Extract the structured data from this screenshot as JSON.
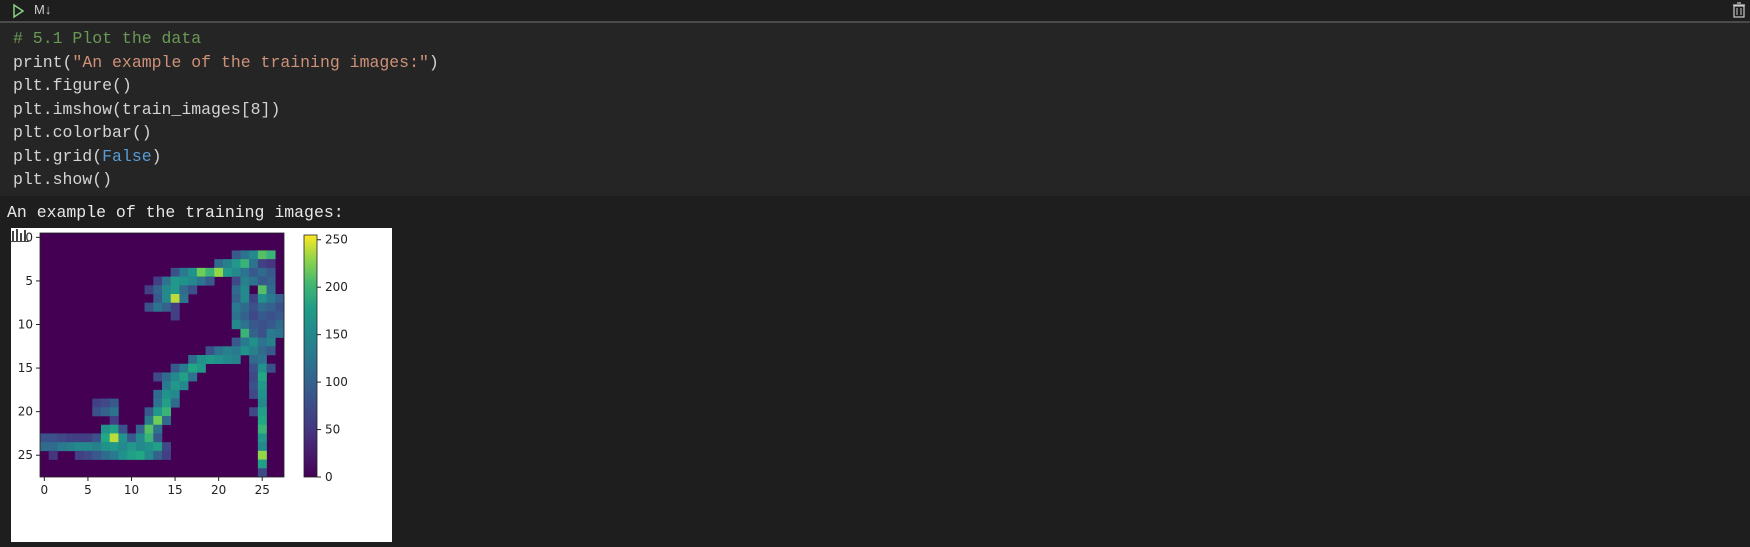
{
  "toolbar": {
    "run_icon": "play-icon",
    "cell_type": "M↓",
    "delete_icon": "trash-icon"
  },
  "code_cell": {
    "lines": [
      [
        {
          "t": "comment",
          "v": "# 5.1 Plot the data"
        }
      ],
      [
        {
          "t": "text",
          "v": "print("
        },
        {
          "t": "string",
          "v": "\"An example of the training images:\""
        },
        {
          "t": "text",
          "v": ")"
        }
      ],
      [
        {
          "t": "text",
          "v": "plt.figure()"
        }
      ],
      [
        {
          "t": "text",
          "v": "plt.imshow(train_images[8])"
        }
      ],
      [
        {
          "t": "text",
          "v": "plt.colorbar()"
        }
      ],
      [
        {
          "t": "text",
          "v": "plt.grid("
        },
        {
          "t": "const",
          "v": "False"
        },
        {
          "t": "text",
          "v": ")"
        }
      ],
      [
        {
          "t": "text",
          "v": "plt.show()"
        }
      ]
    ]
  },
  "output": {
    "text": "An example of the training images:"
  },
  "chart_data": {
    "type": "heatmap",
    "colormap": "viridis",
    "x_ticks": [
      "0",
      "5",
      "10",
      "15",
      "20",
      "25"
    ],
    "y_ticks": [
      "0",
      "5",
      "10",
      "15",
      "20",
      "25"
    ],
    "xlim": [
      0,
      27
    ],
    "ylim": [
      0,
      27
    ],
    "colorbar_ticks": [
      "0",
      "50",
      "100",
      "150",
      "200",
      "250"
    ],
    "colorbar_range": [
      0,
      255
    ],
    "grid": false,
    "rows": 28,
    "cols": 28,
    "nonzero_pixels": [
      [
        2,
        22,
        90
      ],
      [
        2,
        23,
        120
      ],
      [
        2,
        24,
        150
      ],
      [
        2,
        25,
        210
      ],
      [
        2,
        26,
        200
      ],
      [
        3,
        20,
        110
      ],
      [
        3,
        21,
        140
      ],
      [
        3,
        22,
        170
      ],
      [
        3,
        23,
        200
      ],
      [
        3,
        24,
        120
      ],
      [
        3,
        25,
        60
      ],
      [
        3,
        26,
        50
      ],
      [
        4,
        15,
        80
      ],
      [
        4,
        16,
        130
      ],
      [
        4,
        17,
        160
      ],
      [
        4,
        18,
        220
      ],
      [
        4,
        19,
        200
      ],
      [
        4,
        20,
        230
      ],
      [
        4,
        21,
        170
      ],
      [
        4,
        22,
        150
      ],
      [
        4,
        23,
        120
      ],
      [
        4,
        24,
        90
      ],
      [
        4,
        25,
        110
      ],
      [
        4,
        26,
        90
      ],
      [
        5,
        13,
        60
      ],
      [
        5,
        14,
        120
      ],
      [
        5,
        15,
        170
      ],
      [
        5,
        16,
        160
      ],
      [
        5,
        17,
        150
      ],
      [
        5,
        18,
        120
      ],
      [
        5,
        19,
        90
      ],
      [
        5,
        22,
        70
      ],
      [
        5,
        23,
        140
      ],
      [
        5,
        24,
        120
      ],
      [
        5,
        25,
        90
      ],
      [
        5,
        26,
        100
      ],
      [
        6,
        12,
        60
      ],
      [
        6,
        13,
        100
      ],
      [
        6,
        14,
        150
      ],
      [
        6,
        15,
        170
      ],
      [
        6,
        16,
        110
      ],
      [
        6,
        17,
        80
      ],
      [
        6,
        22,
        110
      ],
      [
        6,
        23,
        150
      ],
      [
        6,
        25,
        210
      ],
      [
        6,
        26,
        110
      ],
      [
        7,
        13,
        90
      ],
      [
        7,
        14,
        150
      ],
      [
        7,
        15,
        240
      ],
      [
        7,
        16,
        120
      ],
      [
        7,
        22,
        100
      ],
      [
        7,
        23,
        150
      ],
      [
        7,
        24,
        60
      ],
      [
        7,
        25,
        160
      ],
      [
        7,
        26,
        130
      ],
      [
        7,
        27,
        100
      ],
      [
        8,
        12,
        80
      ],
      [
        8,
        13,
        120
      ],
      [
        8,
        14,
        100
      ],
      [
        8,
        15,
        60
      ],
      [
        8,
        22,
        130
      ],
      [
        8,
        23,
        110
      ],
      [
        8,
        24,
        80
      ],
      [
        8,
        25,
        110
      ],
      [
        8,
        26,
        100
      ],
      [
        8,
        27,
        80
      ],
      [
        9,
        15,
        60
      ],
      [
        9,
        22,
        120
      ],
      [
        9,
        23,
        100
      ],
      [
        9,
        24,
        70
      ],
      [
        9,
        25,
        90
      ],
      [
        9,
        26,
        80
      ],
      [
        9,
        27,
        90
      ],
      [
        10,
        22,
        150
      ],
      [
        10,
        23,
        120
      ],
      [
        10,
        24,
        90
      ],
      [
        10,
        25,
        80
      ],
      [
        10,
        26,
        90
      ],
      [
        10,
        27,
        110
      ],
      [
        11,
        23,
        200
      ],
      [
        11,
        24,
        100
      ],
      [
        11,
        25,
        80
      ],
      [
        11,
        26,
        130
      ],
      [
        11,
        27,
        120
      ],
      [
        12,
        22,
        90
      ],
      [
        12,
        23,
        130
      ],
      [
        12,
        24,
        160
      ],
      [
        12,
        25,
        120
      ],
      [
        12,
        26,
        140
      ],
      [
        13,
        19,
        80
      ],
      [
        13,
        20,
        120
      ],
      [
        13,
        21,
        140
      ],
      [
        13,
        22,
        130
      ],
      [
        13,
        23,
        160
      ],
      [
        13,
        24,
        140
      ],
      [
        13,
        25,
        110
      ],
      [
        13,
        26,
        90
      ],
      [
        14,
        17,
        110
      ],
      [
        14,
        18,
        160
      ],
      [
        14,
        19,
        170
      ],
      [
        14,
        20,
        160
      ],
      [
        14,
        21,
        150
      ],
      [
        14,
        22,
        140
      ],
      [
        14,
        24,
        110
      ],
      [
        14,
        25,
        120
      ],
      [
        15,
        15,
        90
      ],
      [
        15,
        16,
        130
      ],
      [
        15,
        17,
        190
      ],
      [
        15,
        18,
        170
      ],
      [
        15,
        24,
        80
      ],
      [
        15,
        25,
        160
      ],
      [
        15,
        26,
        80
      ],
      [
        16,
        13,
        70
      ],
      [
        16,
        14,
        110
      ],
      [
        16,
        15,
        150
      ],
      [
        16,
        16,
        180
      ],
      [
        16,
        17,
        120
      ],
      [
        16,
        24,
        70
      ],
      [
        16,
        25,
        190
      ],
      [
        17,
        14,
        130
      ],
      [
        17,
        15,
        170
      ],
      [
        17,
        16,
        150
      ],
      [
        17,
        24,
        80
      ],
      [
        17,
        25,
        170
      ],
      [
        18,
        13,
        110
      ],
      [
        18,
        14,
        160
      ],
      [
        18,
        15,
        150
      ],
      [
        18,
        24,
        70
      ],
      [
        18,
        25,
        160
      ],
      [
        19,
        6,
        60
      ],
      [
        19,
        7,
        70
      ],
      [
        19,
        8,
        90
      ],
      [
        19,
        13,
        120
      ],
      [
        19,
        14,
        180
      ],
      [
        19,
        15,
        110
      ],
      [
        19,
        25,
        150
      ],
      [
        20,
        6,
        80
      ],
      [
        20,
        7,
        100
      ],
      [
        20,
        8,
        120
      ],
      [
        20,
        12,
        90
      ],
      [
        20,
        13,
        170
      ],
      [
        20,
        14,
        200
      ],
      [
        20,
        24,
        70
      ],
      [
        20,
        25,
        180
      ],
      [
        21,
        8,
        60
      ],
      [
        21,
        12,
        130
      ],
      [
        21,
        13,
        220
      ],
      [
        21,
        14,
        110
      ],
      [
        21,
        25,
        190
      ],
      [
        22,
        7,
        160
      ],
      [
        22,
        8,
        180
      ],
      [
        22,
        9,
        80
      ],
      [
        22,
        11,
        100
      ],
      [
        22,
        12,
        210
      ],
      [
        22,
        13,
        120
      ],
      [
        22,
        25,
        200
      ],
      [
        23,
        0,
        80
      ],
      [
        23,
        1,
        80
      ],
      [
        23,
        2,
        70
      ],
      [
        23,
        3,
        60
      ],
      [
        23,
        4,
        60
      ],
      [
        23,
        5,
        60
      ],
      [
        23,
        6,
        80
      ],
      [
        23,
        7,
        190
      ],
      [
        23,
        8,
        240
      ],
      [
        23,
        9,
        160
      ],
      [
        23,
        10,
        90
      ],
      [
        23,
        11,
        150
      ],
      [
        23,
        12,
        200
      ],
      [
        23,
        13,
        90
      ],
      [
        23,
        25,
        170
      ],
      [
        24,
        0,
        110
      ],
      [
        24,
        1,
        110
      ],
      [
        24,
        2,
        130
      ],
      [
        24,
        3,
        140
      ],
      [
        24,
        4,
        150
      ],
      [
        24,
        5,
        150
      ],
      [
        24,
        6,
        140
      ],
      [
        24,
        7,
        160
      ],
      [
        24,
        8,
        170
      ],
      [
        24,
        9,
        150
      ],
      [
        24,
        10,
        170
      ],
      [
        24,
        11,
        150
      ],
      [
        24,
        12,
        160
      ],
      [
        24,
        13,
        180
      ],
      [
        24,
        14,
        70
      ],
      [
        24,
        25,
        150
      ],
      [
        25,
        1,
        50
      ],
      [
        25,
        4,
        60
      ],
      [
        25,
        5,
        70
      ],
      [
        25,
        6,
        90
      ],
      [
        25,
        7,
        110
      ],
      [
        25,
        8,
        130
      ],
      [
        25,
        9,
        160
      ],
      [
        25,
        10,
        180
      ],
      [
        25,
        11,
        190
      ],
      [
        25,
        12,
        150
      ],
      [
        25,
        13,
        100
      ],
      [
        25,
        14,
        60
      ],
      [
        25,
        25,
        230
      ],
      [
        26,
        25,
        180
      ],
      [
        27,
        25,
        70
      ]
    ]
  }
}
